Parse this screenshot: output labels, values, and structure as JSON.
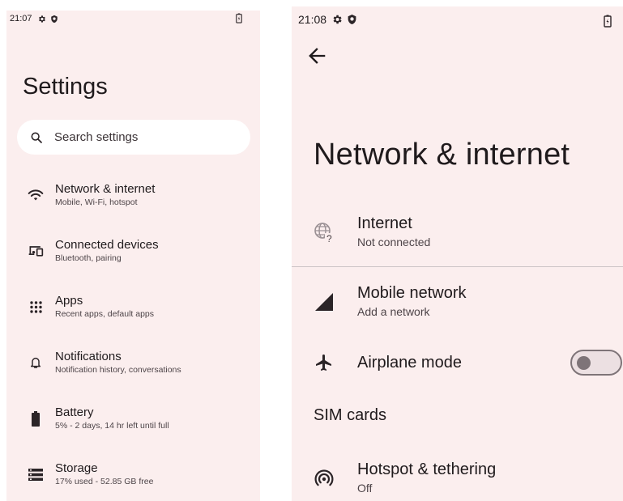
{
  "left": {
    "status": {
      "time": "21:07",
      "icons": [
        "gear-icon",
        "shield-icon",
        "battery-charging-icon"
      ]
    },
    "title": "Settings",
    "search": {
      "placeholder": "Search settings",
      "icon": "search-icon"
    },
    "items": [
      {
        "icon": "wifi-icon",
        "title": "Network & internet",
        "subtitle": "Mobile, Wi-Fi, hotspot"
      },
      {
        "icon": "devices-icon",
        "title": "Connected devices",
        "subtitle": "Bluetooth, pairing"
      },
      {
        "icon": "apps-grid-icon",
        "title": "Apps",
        "subtitle": "Recent apps, default apps"
      },
      {
        "icon": "bell-icon",
        "title": "Notifications",
        "subtitle": "Notification history, conversations"
      },
      {
        "icon": "battery-icon",
        "title": "Battery",
        "subtitle": "5% - 2 days, 14 hr left until full"
      },
      {
        "icon": "storage-icon",
        "title": "Storage",
        "subtitle": "17% used - 52.85 GB free"
      }
    ]
  },
  "right": {
    "status": {
      "time": "21:08",
      "icons": [
        "gear-icon",
        "shield-icon",
        "battery-charging-icon"
      ]
    },
    "back_icon": "back-arrow-icon",
    "title": "Network & internet",
    "internet": {
      "icon": "globe-question-icon",
      "title": "Internet",
      "subtitle": "Not connected"
    },
    "mobile": {
      "icon": "signal-icon",
      "title": "Mobile network",
      "subtitle": "Add a network"
    },
    "airplane": {
      "icon": "airplane-icon",
      "title": "Airplane mode",
      "toggle_on": false
    },
    "sim_label": "SIM cards",
    "hotspot": {
      "icon": "hotspot-icon",
      "title": "Hotspot & tethering",
      "subtitle": "Off"
    }
  },
  "colors": {
    "background": "#fbeeee",
    "text": "#1f1a1c",
    "subtext": "#4d4448",
    "toggle": "#7e7478"
  }
}
